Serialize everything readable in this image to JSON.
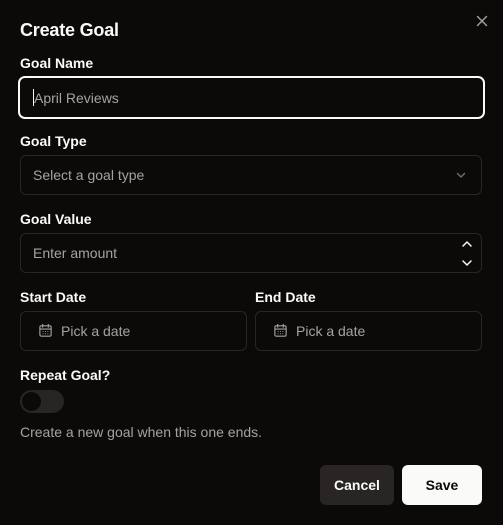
{
  "dialog": {
    "title": "Create Goal",
    "close_icon": "close-icon"
  },
  "goal_name": {
    "label": "Goal Name",
    "placeholder": "April Reviews",
    "value": ""
  },
  "goal_type": {
    "label": "Goal Type",
    "placeholder": "Select a goal type",
    "icon": "chevron-down-icon"
  },
  "goal_value": {
    "label": "Goal Value",
    "placeholder": "Enter amount",
    "icons": [
      "chevron-up-icon",
      "chevron-down-icon"
    ]
  },
  "start_date": {
    "label": "Start Date",
    "placeholder": "Pick a date",
    "icon": "calendar-icon"
  },
  "end_date": {
    "label": "End Date",
    "placeholder": "Pick a date",
    "icon": "calendar-icon"
  },
  "repeat": {
    "label": "Repeat Goal?",
    "enabled": false,
    "helper": "Create a new goal when this one ends."
  },
  "actions": {
    "cancel_label": "Cancel",
    "save_label": "Save"
  },
  "colors": {
    "background": "#0c0a09",
    "border": "#292524",
    "focus_border": "#fafaf9",
    "text": "#fafaf9",
    "muted_text": "#a8a29e",
    "primary_button": "#fafaf9"
  }
}
